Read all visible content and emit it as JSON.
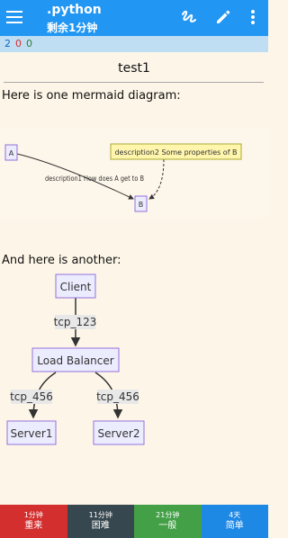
{
  "app_bar": {
    "title": ".python",
    "subtitle": "剩余1分钟"
  },
  "counts": {
    "new": "2",
    "learning": "0",
    "review": "0"
  },
  "card": {
    "deck_title": "test1",
    "intro_text": "Here is one mermaid diagram:",
    "second_text": "And here is another:",
    "diagram1": {
      "node_a": "A",
      "node_b": "B",
      "edge_label": "description1 How does A get to B",
      "note_text": "description2 Some properties of B"
    },
    "diagram2": {
      "client": "Client",
      "edge_top": "tcp_123",
      "load_balancer": "Load Balancer",
      "edge_left": "tcp_456",
      "edge_right": "tcp_456",
      "server1": "Server1",
      "server2": "Server2"
    }
  },
  "answer_buttons": {
    "again": {
      "time": "1分钟",
      "label": "重来"
    },
    "hard": {
      "time": "11分钟",
      "label": "困难"
    },
    "good": {
      "time": "21分钟",
      "label": "一般"
    },
    "easy": {
      "time": "4天",
      "label": "简单"
    }
  },
  "icons": [
    "menu-icon",
    "whiteboard-icon",
    "edit-pencil-icon",
    "more-vert-icon"
  ],
  "colors": {
    "app_bar": "#2196f3",
    "again": "#d32f2f",
    "hard": "#37474f",
    "good": "#43a047",
    "easy": "#1e88e5"
  }
}
